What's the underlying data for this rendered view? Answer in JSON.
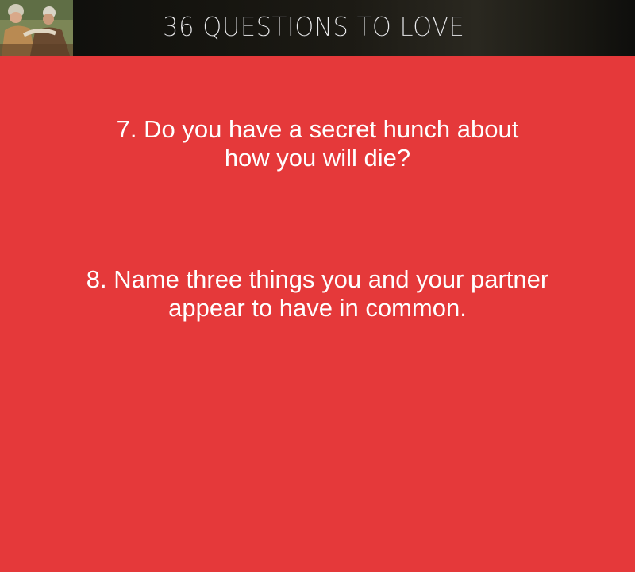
{
  "header": {
    "title": "36 QUESTIONS TO LOVE",
    "photo_icon": "elderly-couple-photo"
  },
  "questions": [
    {
      "lines": [
        "7. Do you have a secret hunch about",
        "how you will die?"
      ]
    },
    {
      "lines": [
        "8. Name three things you and your partner",
        "appear to have in common."
      ]
    }
  ],
  "colors": {
    "background": "#e5393a",
    "header": "#1a1913",
    "text": "#ffffff"
  }
}
